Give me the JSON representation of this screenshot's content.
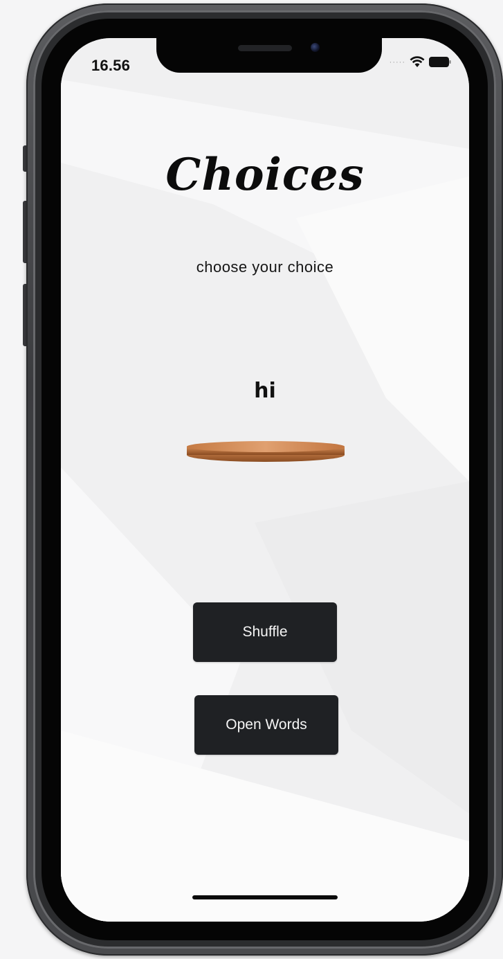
{
  "status_bar": {
    "time": "16.56",
    "signal_icon": "cellular-dots-icon",
    "wifi_icon": "wifi-icon",
    "battery_icon": "battery-icon"
  },
  "app": {
    "title": "Choices",
    "subtitle": "choose your choice",
    "current_word": "hi",
    "plate_icon": "wooden-plate-icon"
  },
  "buttons": {
    "shuffle_label": "Shuffle",
    "open_words_label": "Open Words"
  },
  "colors": {
    "button_bg": "#1f2124",
    "button_text": "#f5f5f5",
    "plate_wood": "#c47a45",
    "screen_bg": "#f1f1f2"
  }
}
